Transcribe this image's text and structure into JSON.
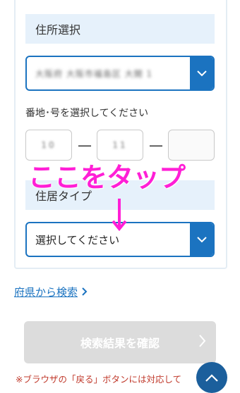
{
  "address": {
    "heading": "住所選択",
    "selected_value": "大阪府 大阪市福島区 大開 1"
  },
  "street_number": {
    "label": "番地･号を選択してください",
    "field1_value": "10",
    "dash1": "—",
    "field2_value": "11",
    "dash2": "—",
    "field3_value": ""
  },
  "overlay": {
    "instruction": "ここをタップ",
    "color": "#ff1fd6"
  },
  "residence": {
    "heading": "住居タイプ",
    "select_value": "選択してください"
  },
  "search_from_prefecture": {
    "label": "府県から検索"
  },
  "confirm": {
    "label": "検索結果を確認"
  },
  "note": {
    "text": "※ブラウザの「戻る」ボタンには対応して"
  },
  "colors": {
    "accent": "#1b73c0",
    "section_bg": "#e6f1fb",
    "disabled_button": "#dcdcdc",
    "note": "#c0392b"
  }
}
